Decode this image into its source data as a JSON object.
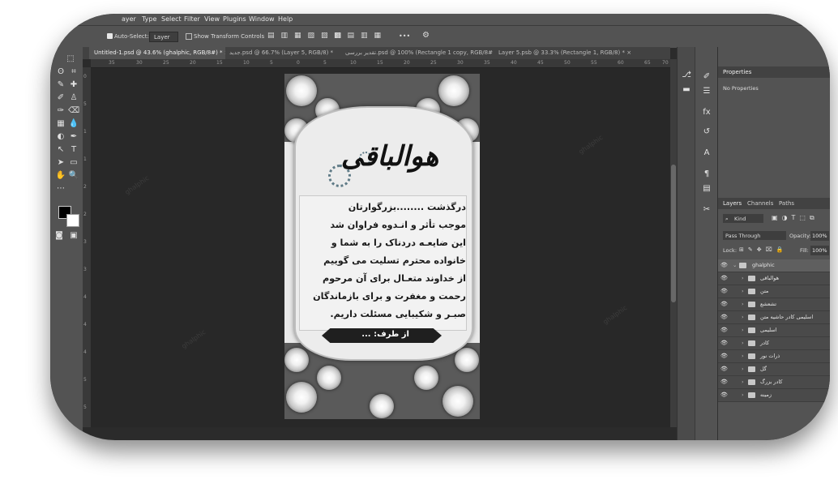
{
  "menu": [
    "ayer",
    "Type",
    "Select",
    "Filter",
    "View",
    "Plugins",
    "Window",
    "Help"
  ],
  "options": {
    "auto_select_label": "Auto-Select:",
    "auto_select_value": "Layer",
    "transform_label": "Show Transform Controls",
    "more": "•••"
  },
  "tabs": [
    {
      "label": "Untitled-1.psd @ 43.6% (ghalphic, RGB/8#) *"
    },
    {
      "label": "جدید.psd @ 66.7% (Layer 5, RGB/8) *"
    },
    {
      "label": "تقدیر بررسی.psd @ 100% (Rectangle 1 copy, RGB/8#)"
    },
    {
      "label": "Layer 5.psb @ 33.3% (Rectangle 1, RGB/8) *"
    }
  ],
  "tab_close": "×",
  "hruler": [
    "35",
    "30",
    "25",
    "20",
    "15",
    "10",
    "5",
    "0",
    "5",
    "10",
    "15",
    "20",
    "25",
    "30",
    "35",
    "40",
    "45",
    "50",
    "55",
    "60",
    "65",
    "70"
  ],
  "vruler": [
    "0",
    "5",
    "1",
    "1",
    "2",
    "2",
    "3",
    "3",
    "4",
    "4",
    "4",
    "5",
    "5"
  ],
  "document": {
    "title_calligraphy": "هوالباقی",
    "lines": [
      "درگذشت ........بزرگوارتان",
      "موجب تأثر و انـدوه فراوان شد",
      "این ضایعـه دردناک را به شما و",
      "خانواده محترم تسلیت می گوییم",
      "از خداوند متعـال برای آن مرحوم",
      "رحمت و مغفرت و برای بازماندگان",
      "صبـر و شکیبایی مسئلت داریم."
    ],
    "from_label": "از طرف: ...",
    "watermark": "ghalphic"
  },
  "properties": {
    "tab": "Properties",
    "empty": "No Properties"
  },
  "layers_panel": {
    "tabs": [
      "Layers",
      "Channels",
      "Paths"
    ],
    "filter": "Kind",
    "blend": "Pass Through",
    "opacity_label": "Opacity:",
    "opacity": "100%",
    "lock_label": "Lock:",
    "fill_label": "Fill:",
    "fill": "100%",
    "group": "ghalphic",
    "items": [
      "هوالباقی",
      "متن",
      "تشعشع",
      "اسلیمی کادر حاشیه متن",
      "اسلیمی",
      "کادر",
      "ذرات نور",
      "گل",
      "کادر بزرگ",
      "زمینه"
    ]
  },
  "colors": {
    "accent": "#535353",
    "canvas": "#282828",
    "panel": "#424242"
  }
}
